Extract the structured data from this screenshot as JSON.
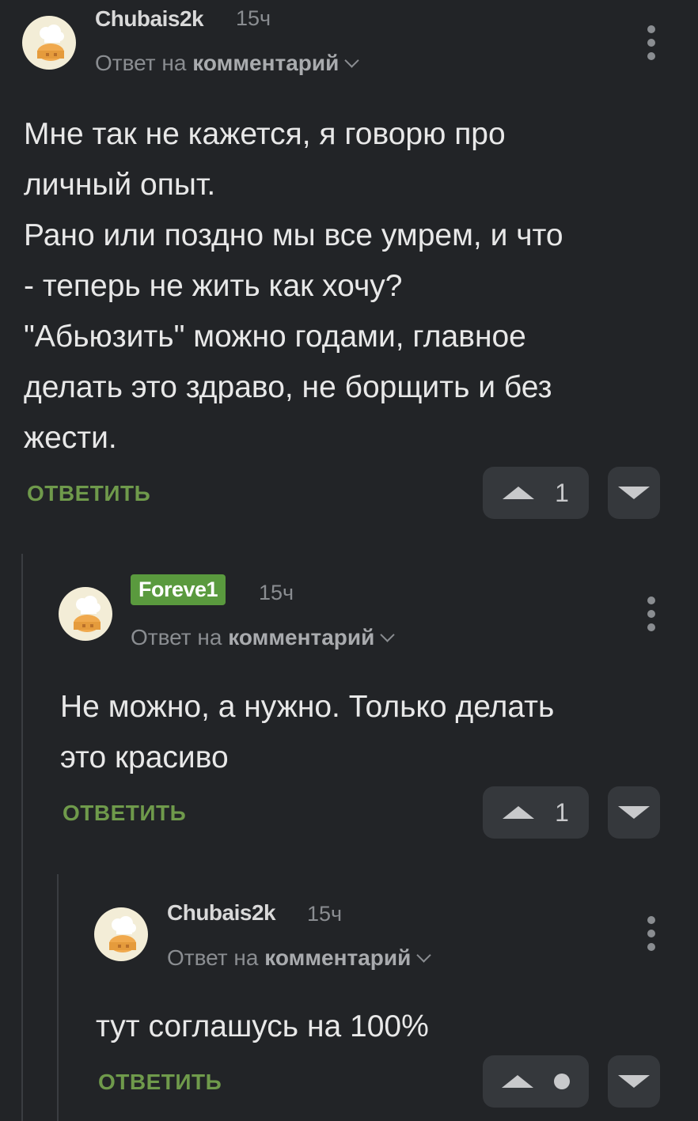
{
  "comments": [
    {
      "author": "Chubais2k",
      "time": "15ч",
      "reply_prefix": "Ответ на",
      "reply_target": "комментарий",
      "text_lines": [
        "Мне так не кажется, я говорю про",
        "личный опыт.",
        "Рано или поздно мы все умрем, и что",
        "- теперь не жить как хочу?",
        "\"Абьюзить\" можно годами, главное",
        "делать это здраво, не борщить и без",
        "жести."
      ],
      "answer_label": "ОТВЕТИТЬ",
      "votes": "1"
    },
    {
      "author": "Foreve1",
      "time": "15ч",
      "reply_prefix": "Ответ на",
      "reply_target": "комментарий",
      "text_lines": [
        "Не можно, а нужно. Только делать",
        "это красиво"
      ],
      "answer_label": "ОТВЕТИТЬ",
      "votes": "1"
    },
    {
      "author": "Chubais2k",
      "time": "15ч",
      "reply_prefix": "Ответ на",
      "reply_target": "комментарий",
      "text_lines": [
        "тут соглашусь на 100%"
      ],
      "answer_label": "ОТВЕТИТЬ",
      "votes": ""
    }
  ],
  "icons": {
    "avatar": "chef-hat-bun-icon",
    "menu": "more-vertical-icon",
    "upvote": "triangle-up-icon",
    "downvote": "triangle-down-icon",
    "expand": "chevron-down-icon"
  },
  "colors": {
    "background": "#222427",
    "accent": "#6f9a4b",
    "badge": "#5a9a3e"
  }
}
